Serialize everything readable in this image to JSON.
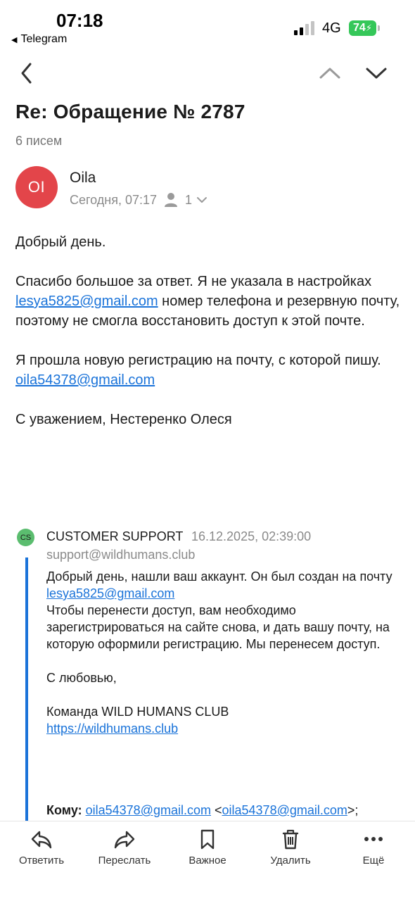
{
  "status_bar": {
    "time": "07:18",
    "back_app": "Telegram",
    "network": "4G",
    "battery": "74"
  },
  "header": {
    "subject": "Re: Обращение № 2787",
    "count": "6 писем"
  },
  "sender": {
    "initials": "OI",
    "name": "Oila",
    "time": "Сегодня, 07:17",
    "recipients_count": "1",
    "avatar_color": "#e3454a"
  },
  "message": {
    "greeting": "Добрый день.",
    "p2_part1": "Спасибо большое за ответ. Я не указала в настройках ",
    "p2_link": "lesya5825@gmail.com",
    "p2_part2": " номер телефона и резервную почту, поэтому не смогла восстановить доступ к этой почте.",
    "p3": "Я прошла новую регистрацию на почту, с которой пишу.",
    "p3_link": "oila54378@gmail.com",
    "signature": "С уважением, Нестеренко Олеся"
  },
  "quoted": {
    "badge": "CS",
    "name": "CUSTOMER SUPPORT",
    "date": "16.12.2025, 02:39:00",
    "email": "support@wildhumans.club",
    "line1": "Добрый день, нашли ваш аккаунт. Он был создан на почту",
    "link1": "lesya5825@gmail.com",
    "line2": "Чтобы перенести доступ, вам необходимо зарегистрироваться на сайте снова, и дать вашу почту, на которую оформили регистрацию. Мы перенесем доступ.",
    "closing": "С любовью,",
    "team": "Команда WILD HUMANS CLUB",
    "site_link": "https://wildhumans.club",
    "to_label": "Кому:",
    "to_email": "oila54378@gmail.com",
    "to_lt": " <",
    "to_email2": "oila54378@gmail.com",
    "to_gt": ">;"
  },
  "toolbar": {
    "reply": "Ответить",
    "forward": "Переслать",
    "important": "Важное",
    "delete": "Удалить",
    "more": "Ещё"
  },
  "colors": {
    "link": "#1a73d9",
    "battery": "#35c759",
    "cs_badge": "#5bbd6f"
  }
}
